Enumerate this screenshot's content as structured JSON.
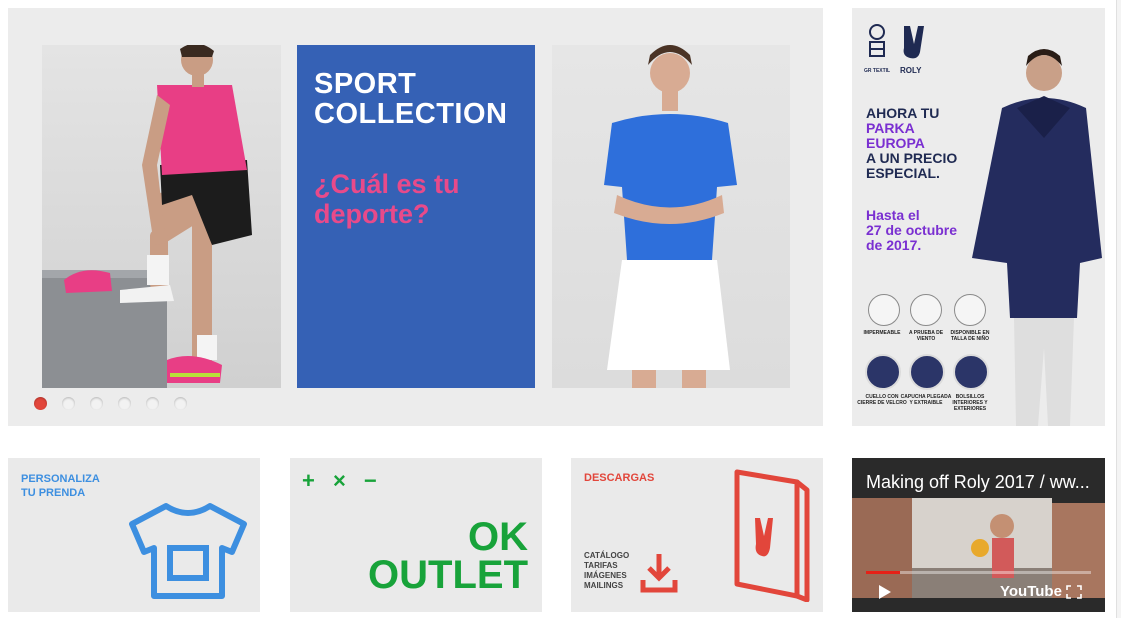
{
  "hero": {
    "sport_title_1": "SPORT",
    "sport_title_2": "COLLECTION",
    "question_1": "¿Cuál es tu",
    "question_2": "deporte?",
    "dots_count": 6,
    "active_dot": 1
  },
  "promo": {
    "logo_left": "GR TEXTIL",
    "logo_right": "ROLY",
    "line1": "AHORA TU",
    "line2": "PARKA",
    "line3": "EUROPA",
    "line4": "A UN PRECIO",
    "line5": "ESPECIAL.",
    "date1": "Hasta el",
    "date2": "27 de octubre",
    "date3": "de 2017.",
    "features": [
      "IMPERMEABLE",
      "A PRUEBA DE VIENTO",
      "DISPONIBLE EN TALLA DE NIÑO"
    ],
    "details": [
      "CUELLO CON CIERRE DE VELCRO",
      "CAPUCHA PLEGADA Y EXTRAIBLE",
      "BOLSILLOS INTERIORES Y EXTERIORES"
    ]
  },
  "tiles": {
    "personaliza_1": "PERSONALIZA",
    "personaliza_2": "TU PRENDA",
    "outlet_symbols": "+ × −",
    "outlet_1": "OK",
    "outlet_2": "OUTLET",
    "descargas": "DESCARGAS",
    "descargas_items": [
      "CATÁLOGO",
      "TARIFAS",
      "IMÁGENES",
      "MAILINGS"
    ]
  },
  "video": {
    "title": "Making off Roly 2017 / ww...",
    "brand": "YouTube"
  },
  "colors": {
    "sport_blue": "#3561b5",
    "pink": "#e84a8a",
    "shirt_blue": "#3d8fe0",
    "outlet_green": "#18a33a",
    "download_red": "#e2463b",
    "promo_navy": "#1f2a52",
    "promo_purple": "#7a2fd1"
  }
}
